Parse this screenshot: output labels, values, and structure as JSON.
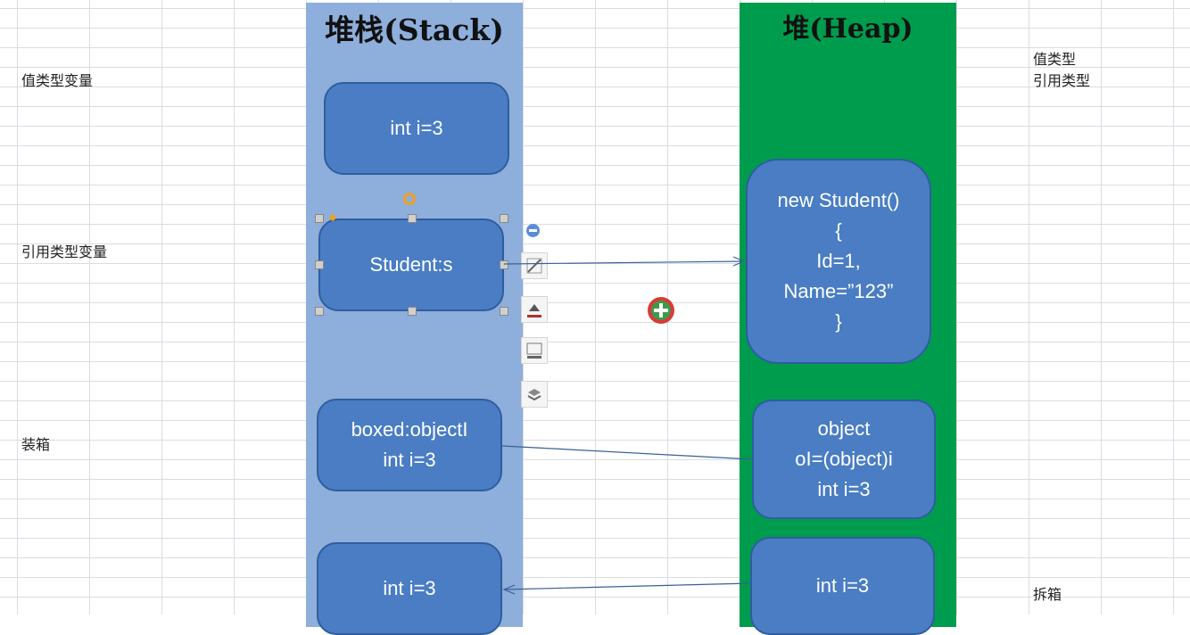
{
  "sheet": {
    "row_labels": {
      "value_type_var": "值类型变量",
      "ref_type_var": "引用类型变量",
      "boxing": "装箱"
    },
    "right_labels": {
      "value_type": "值类型",
      "ref_type": "引用类型",
      "unboxing": "拆箱"
    }
  },
  "stack": {
    "title": "堆栈(Stack)",
    "boxes": {
      "int_i": "int i=3",
      "student": "Student:s",
      "boxed_line1": "boxed:objectI",
      "boxed_line2": "int i=3",
      "int_unboxed": "int i=3"
    }
  },
  "heap": {
    "title": "堆(Heap)",
    "student_obj": {
      "line1": "new Student()",
      "line2": "{",
      "line3": "Id=1,",
      "line4": "Name=”123”",
      "line5": "}"
    },
    "boxed_obj": {
      "line1": "object",
      "line2": "oI=(object)i",
      "line3": "int i=3"
    },
    "int_obj": "int i=3"
  },
  "colors": {
    "stack_bg": "#8eaedb",
    "heap_bg": "#009c4d",
    "box_fill": "#4a7dc3"
  }
}
